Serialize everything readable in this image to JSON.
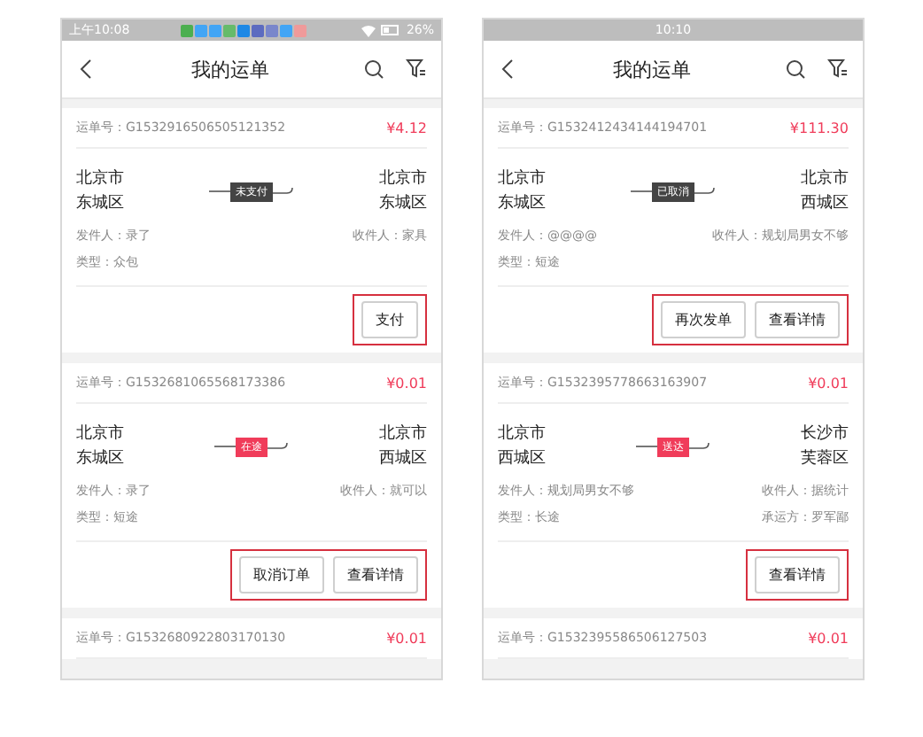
{
  "phones": [
    {
      "status_bar": {
        "time": "上午10:08",
        "battery": "26%",
        "notifications": true
      },
      "title": "我的运单",
      "orders": [
        {
          "order_no": "运单号：G1532916506505121352",
          "price": "¥4.12",
          "origin": [
            "北京市",
            "东城区"
          ],
          "destination": [
            "北京市",
            "东城区"
          ],
          "status": {
            "label": "未支付",
            "color": "#444444"
          },
          "details": [
            {
              "left": "发件人：录了",
              "right": "收件人：家具"
            },
            {
              "left": "类型：众包"
            }
          ],
          "actions": [
            "支付"
          ],
          "highlighted": true
        },
        {
          "order_no": "运单号：G1532681065568173386",
          "price": "¥0.01",
          "origin": [
            "北京市",
            "东城区"
          ],
          "destination": [
            "北京市",
            "西城区"
          ],
          "status": {
            "label": "在途",
            "color": "#f03c5a"
          },
          "details": [
            {
              "left": "发件人：录了",
              "right": "收件人：就可以"
            },
            {
              "left": "类型：短途"
            }
          ],
          "actions": [
            "取消订单",
            "查看详情"
          ],
          "highlighted": true
        },
        {
          "order_no": "运单号：G1532680922803170130",
          "price": "¥0.01"
        }
      ]
    },
    {
      "status_bar": {
        "time": "10:10",
        "notifications": false
      },
      "title": "我的运单",
      "orders": [
        {
          "order_no": "运单号：G1532412434144194701",
          "price": "¥111.30",
          "origin": [
            "北京市",
            "东城区"
          ],
          "destination": [
            "北京市",
            "西城区"
          ],
          "status": {
            "label": "已取消",
            "color": "#444444"
          },
          "details": [
            {
              "left": "发件人：@@@@",
              "right": "收件人：规划局男女不够"
            },
            {
              "left": "类型：短途"
            }
          ],
          "actions": [
            "再次发单",
            "查看详情"
          ],
          "highlighted": true
        },
        {
          "order_no": "运单号：G1532395778663163907",
          "price": "¥0.01",
          "origin": [
            "北京市",
            "西城区"
          ],
          "destination": [
            "长沙市",
            "芙蓉区"
          ],
          "status": {
            "label": "送达",
            "color": "#f03c5a"
          },
          "details": [
            {
              "left": "发件人：规划局男女不够",
              "right": "收件人：据统计"
            },
            {
              "left": "类型：长途",
              "right": "承运方：罗军鄙"
            }
          ],
          "actions": [
            "查看详情"
          ],
          "highlighted": true
        },
        {
          "order_no": "运单号：G1532395586506127503",
          "price": "¥0.01"
        }
      ]
    }
  ]
}
